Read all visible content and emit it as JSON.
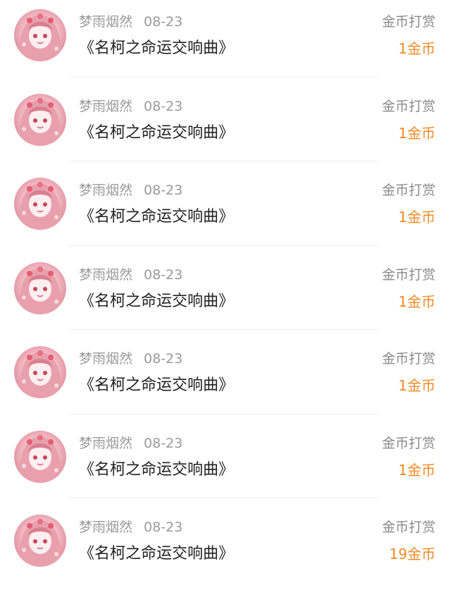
{
  "items": [
    {
      "username": "梦雨烟然",
      "date": "08-23",
      "title": "《名柯之命运交响曲》",
      "type_label": "金币打赏",
      "amount": "1金币"
    },
    {
      "username": "梦雨烟然",
      "date": "08-23",
      "title": "《名柯之命运交响曲》",
      "type_label": "金币打赏",
      "amount": "1金币"
    },
    {
      "username": "梦雨烟然",
      "date": "08-23",
      "title": "《名柯之命运交响曲》",
      "type_label": "金币打赏",
      "amount": "1金币"
    },
    {
      "username": "梦雨烟然",
      "date": "08-23",
      "title": "《名柯之命运交响曲》",
      "type_label": "金币打赏",
      "amount": "1金币"
    },
    {
      "username": "梦雨烟然",
      "date": "08-23",
      "title": "《名柯之命运交响曲》",
      "type_label": "金币打赏",
      "amount": "1金币"
    },
    {
      "username": "梦雨烟然",
      "date": "08-23",
      "title": "《名柯之命运交响曲》",
      "type_label": "金币打赏",
      "amount": "1金币"
    },
    {
      "username": "梦雨烟然",
      "date": "08-23",
      "title": "《名柯之命运交响曲》",
      "type_label": "金币打赏",
      "amount": "19金币"
    }
  ],
  "colors": {
    "amount": "#f08a24",
    "meta": "#9a9a9a",
    "title": "#222222",
    "divider": "#f0f0f0"
  }
}
